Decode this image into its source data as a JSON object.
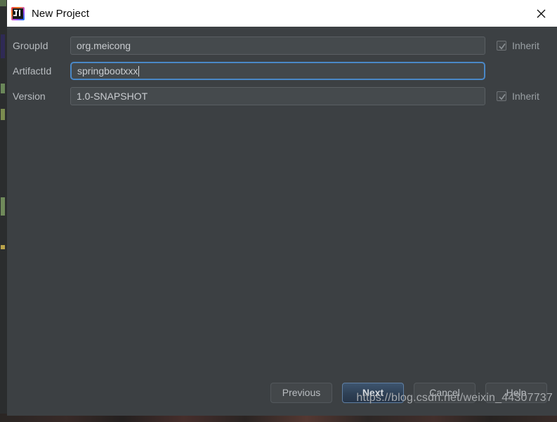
{
  "window": {
    "title": "New Project",
    "app_icon": "intellij-idea-icon",
    "close_icon": "close-icon"
  },
  "form": {
    "rows": [
      {
        "label": "GroupId",
        "value": "org.meicong",
        "focused": false,
        "has_inherit": true,
        "inherit_label": "Inherit",
        "inherit_checked": true
      },
      {
        "label": "ArtifactId",
        "value": "springbootxxx",
        "focused": true,
        "has_inherit": false,
        "inherit_label": "",
        "inherit_checked": false
      },
      {
        "label": "Version",
        "value": "1.0-SNAPSHOT",
        "focused": false,
        "has_inherit": true,
        "inherit_label": "Inherit",
        "inherit_checked": true
      }
    ]
  },
  "footer": {
    "previous_label": "Previous",
    "next_label": "Next",
    "cancel_label": "Cancel",
    "help_label": "Help"
  },
  "watermark": {
    "text": "https://blog.csdn.net/weixin_44307737"
  },
  "colors": {
    "dialog_background": "#3c4043",
    "titlebar_background": "#ffffff",
    "field_background": "#454a4d",
    "focus_border": "#4a88c7",
    "default_button": "#2e4055",
    "label_text": "#b8bcc0"
  }
}
